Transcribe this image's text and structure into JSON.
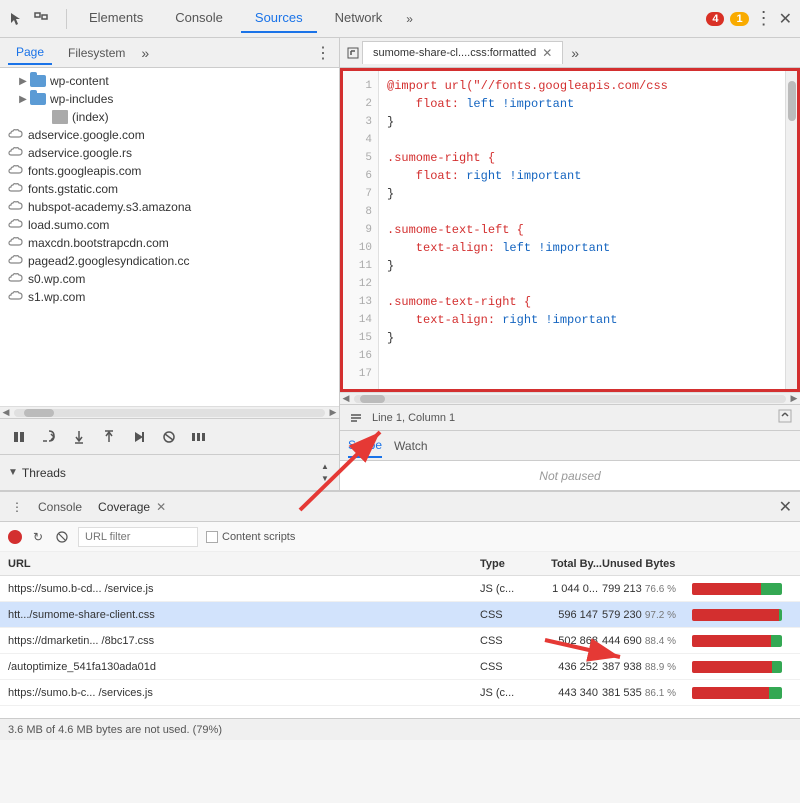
{
  "toolbar": {
    "cursor_icon": "⬚",
    "box_icon": "□",
    "elements_tab": "Elements",
    "console_tab": "Console",
    "sources_tab": "Sources",
    "network_tab": "Network",
    "more_tabs_icon": "»",
    "error_count": "4",
    "warn_count": "1",
    "dots_icon": "⋮",
    "close_icon": "✕"
  },
  "left_panel": {
    "page_tab": "Page",
    "filesystem_tab": "Filesystem",
    "more_tab": "»",
    "options_icon": "⋮",
    "tree_items": [
      {
        "indent": 1,
        "type": "folder",
        "name": "wp-content",
        "expanded": false
      },
      {
        "indent": 1,
        "type": "folder",
        "name": "wp-includes",
        "expanded": false
      },
      {
        "indent": 2,
        "type": "file",
        "name": "(index)"
      },
      {
        "indent": 0,
        "type": "cloud",
        "name": "adservice.google.com"
      },
      {
        "indent": 0,
        "type": "cloud",
        "name": "adservice.google.rs"
      },
      {
        "indent": 0,
        "type": "cloud",
        "name": "fonts.googleapis.com"
      },
      {
        "indent": 0,
        "type": "cloud",
        "name": "fonts.gstatic.com"
      },
      {
        "indent": 0,
        "type": "cloud",
        "name": "hubspot-academy.s3.amazona"
      },
      {
        "indent": 0,
        "type": "cloud",
        "name": "load.sumo.com"
      },
      {
        "indent": 0,
        "type": "cloud",
        "name": "maxcdn.bootstrapcdn.com"
      },
      {
        "indent": 0,
        "type": "cloud",
        "name": "pagead2.googlesyndication.cc"
      },
      {
        "indent": 0,
        "type": "cloud",
        "name": "s0.wp.com"
      },
      {
        "indent": 0,
        "type": "cloud",
        "name": "s1.wp.com"
      }
    ]
  },
  "debug_toolbar": {
    "pause_icon": "⏸",
    "step_over": "↻",
    "step_into": "↓",
    "step_out": "↑",
    "continue": "→",
    "breakpoints": "⊘",
    "pause_async": "⏸"
  },
  "threads": {
    "label": "Threads"
  },
  "editor": {
    "tab_label": "sumome-share-cl....css:formatted",
    "close_icon": "✕",
    "more_tabs": "»",
    "lines": [
      {
        "num": 1,
        "content": "@import url(\"//fonts.googleapis.com/css",
        "type": "at"
      },
      {
        "num": 2,
        "content": "    float: left !important",
        "type": "prop"
      },
      {
        "num": 3,
        "content": "}",
        "type": "brace"
      },
      {
        "num": 4,
        "content": "",
        "type": "empty"
      },
      {
        "num": 5,
        "content": ".sumome-right {",
        "type": "selector"
      },
      {
        "num": 6,
        "content": "    float: right !important",
        "type": "prop"
      },
      {
        "num": 7,
        "content": "}",
        "type": "brace"
      },
      {
        "num": 8,
        "content": "",
        "type": "empty"
      },
      {
        "num": 9,
        "content": ".sumome-text-left {",
        "type": "selector"
      },
      {
        "num": 10,
        "content": "    text-align: left !important",
        "type": "prop"
      },
      {
        "num": 11,
        "content": "}",
        "type": "brace"
      },
      {
        "num": 12,
        "content": "",
        "type": "empty"
      },
      {
        "num": 13,
        "content": ".sumome-text-right {",
        "type": "selector"
      },
      {
        "num": 14,
        "content": "    text-align: right !important",
        "type": "prop"
      },
      {
        "num": 15,
        "content": "}",
        "type": "brace"
      },
      {
        "num": 16,
        "content": "",
        "type": "empty"
      },
      {
        "num": 17,
        "content": "",
        "type": "empty"
      }
    ],
    "status": {
      "position": "Line 1, Column 1"
    }
  },
  "debug_right": {
    "scope_tab": "Scope",
    "watch_tab": "Watch",
    "status": "Not paused"
  },
  "bottom_panel": {
    "options_icon": "⋮",
    "console_tab": "Console",
    "coverage_tab": "Coverage",
    "close_icon": "✕",
    "record_btn": "●",
    "refresh_icon": "↻",
    "clear_icon": "🚫",
    "filter_placeholder": "URL filter",
    "content_scripts_label": "Content scripts",
    "columns": {
      "url": "URL",
      "type": "Type",
      "total": "Total By...",
      "unused": "Unused Bytes",
      "bar": ""
    },
    "rows": [
      {
        "url": "https://sumo.b-cd... /service.js",
        "type": "JS (c...",
        "total": "1 044 0...",
        "unused": "799 213",
        "pct": "76.6 %",
        "used_pct": 23,
        "unused_pct": 77,
        "selected": false
      },
      {
        "url": "htt.../sumome-share-client.css",
        "type": "CSS",
        "total": "596 147",
        "unused": "579 230",
        "pct": "97.2 %",
        "used_pct": 3,
        "unused_pct": 97,
        "selected": true
      },
      {
        "url": "https://dmarketin... /8bc17.css",
        "type": "CSS",
        "total": "502 868",
        "unused": "444 690",
        "pct": "88.4 %",
        "used_pct": 12,
        "unused_pct": 88,
        "selected": false
      },
      {
        "url": "/autoptimize_541fa130ada01d",
        "type": "CSS",
        "total": "436 252",
        "unused": "387 938",
        "pct": "88.9 %",
        "used_pct": 11,
        "unused_pct": 89,
        "selected": false
      },
      {
        "url": "https://sumo.b-c... /services.js",
        "type": "JS (c...",
        "total": "443 340",
        "unused": "381 535",
        "pct": "86.1 %",
        "used_pct": 14,
        "unused_pct": 86,
        "selected": false
      }
    ],
    "status_bar": "3.6 MB of 4.6 MB bytes are not used. (79%)"
  }
}
